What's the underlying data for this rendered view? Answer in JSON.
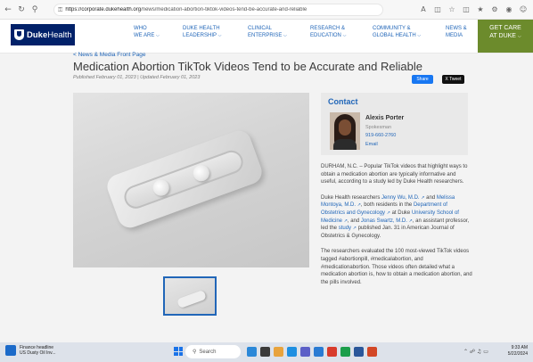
{
  "browser": {
    "url_host": "https://corporate.dukehealth.org",
    "url_path": "/news/medication-abortion-tiktok-videos-tend-be-accurate-and-reliable"
  },
  "header": {
    "logo_duke": "Duke",
    "logo_health": "Health",
    "nav": [
      {
        "line1": "WHO",
        "line2": "WE ARE"
      },
      {
        "line1": "DUKE HEALTH",
        "line2": "LEADERSHIP"
      },
      {
        "line1": "CLINICAL",
        "line2": "ENTERPRISE"
      },
      {
        "line1": "RESEARCH &",
        "line2": "EDUCATION"
      },
      {
        "line1": "COMMUNITY &",
        "line2": "GLOBAL HEALTH"
      },
      {
        "line1": "NEWS &",
        "line2": "MEDIA"
      }
    ],
    "get_care_line1": "GET CARE",
    "get_care_line2": "AT DUKE"
  },
  "article": {
    "breadcrumb": "< News & Media Front Page",
    "title": "Medication Abortion TikTok Videos Tend to be Accurate and Reliable",
    "published": "Published February 01, 2023 | Updated February 01, 2023",
    "share_label": "Share",
    "tweet_label": "X Tweet"
  },
  "contact": {
    "heading": "Contact",
    "name": "Alexis Porter",
    "role": "Spokesman",
    "phone": "919-660-2760",
    "email": "Email"
  },
  "body": {
    "p1": "DURHAM, N.C. – Popular TikTok videos that highlight ways to obtain a medication abortion are typically informative and useful, according to a study led by Duke Health researchers.",
    "p2_a": "Duke Health researchers ",
    "p2_link1": "Jenny Wu, M.D.",
    "p2_b": " and ",
    "p2_link2": "Melissa Montoya, M.D.",
    "p2_c": ", both residents in the ",
    "p2_link3": "Department of Obstetrics and Gynecology",
    "p2_d": " at Duke ",
    "p2_link4": "University School of Medicine",
    "p2_e": ", and ",
    "p2_link5": "Jonas Swartz, M.D.",
    "p2_f": ", an assistant professor, led the ",
    "p2_link6": "study",
    "p2_g": " published Jan. 31 in American Journal of Obstetrics & Gynecology.",
    "p3": "The researchers evaluated the 100 most-viewed TikTok videos tagged #abortionpill, #medicalabortion, and #medicationabortion. Those videos often detailed what a medication abortion is, how to obtain a medication abortion, and the pills involved."
  },
  "taskbar": {
    "news_title": "Finance headline",
    "news_sub": "US Dusty Oil Inv...",
    "search_label": "Search",
    "time": "9:33 AM",
    "date": "5/22/2024"
  }
}
